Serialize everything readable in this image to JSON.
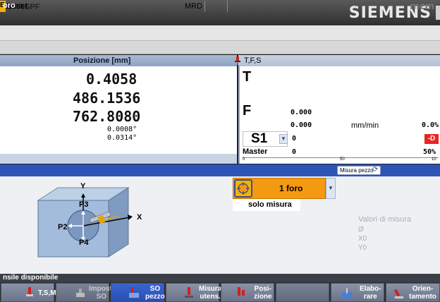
{
  "brand": "SIEMENS",
  "program": {
    "name": "3ORT.SPF",
    "logo": "mcm"
  },
  "status": {
    "reset_prefix": "E",
    "reset": "Reset",
    "mrd": "MRD"
  },
  "position": {
    "title": "Posizione [mm]",
    "values": [
      "0.4058",
      "486.1536",
      "762.8080",
      "0.0008°",
      "0.0314°"
    ]
  },
  "tfs": {
    "title": "T,F,S",
    "T": "T",
    "F": "F",
    "feed_value": "0.000",
    "feed_actual": "0.000",
    "feed_unit": "mm/min",
    "feed_pct": "0.0%",
    "spindle": "S1",
    "spindle_value": "0",
    "spindle_indicator": "-D",
    "master_label": "Master",
    "master_value": "0",
    "master_pct": "50%",
    "scale": [
      "0",
      "50",
      "10"
    ]
  },
  "cycle": {
    "title": "oro",
    "measure_button": "Misura pezzo",
    "selection": "1 foro",
    "mode": "solo misura",
    "diagram_labels": {
      "y": "Y",
      "x": "X",
      "p2": "P2",
      "p3": "P3",
      "p4": "P4"
    },
    "results_title": "Valori di misura",
    "results": [
      "Ø",
      "X0",
      "Y0"
    ]
  },
  "message": "nsile disponibile",
  "softkeys": [
    {
      "label": "T,S,M",
      "icon": "tool-spindle-icon",
      "active": false,
      "enabled": true
    },
    {
      "label": "Impost.\nSO",
      "icon": "settings-icon",
      "active": false,
      "enabled": false
    },
    {
      "label": "SO\npezzo",
      "icon": "workpiece-icon",
      "active": true,
      "enabled": true
    },
    {
      "label": "Misura\nutens.",
      "icon": "measure-tool-icon",
      "active": false,
      "enabled": true
    },
    {
      "label": "Posi-\nzione",
      "icon": "position-icon",
      "active": false,
      "enabled": true
    },
    {
      "label": "",
      "icon": "",
      "active": false,
      "enabled": true
    },
    {
      "label": "Elabo-\nrare",
      "icon": "process-icon",
      "active": false,
      "enabled": true
    },
    {
      "label": "Orien-\ntamento",
      "icon": "orientation-icon",
      "active": false,
      "enabled": true
    }
  ],
  "colors": {
    "header_blue": "#2e53b6",
    "selection_orange": "#f39a12",
    "alert_red": "#e22222"
  }
}
